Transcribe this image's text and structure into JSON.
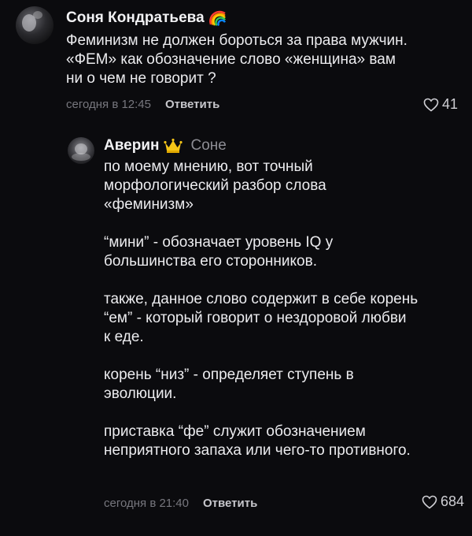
{
  "comments": [
    {
      "author": "Соня Кондратьева",
      "text": "Феминизм не должен бороться за права мужчин.\n«ФЕМ» как обозначение слово «женщина» вам\nни о чем не говорит ?",
      "time": "сегодня в 12:45",
      "reply_label": "Ответить",
      "likes": "41",
      "badge_icon": "rainbow-icon"
    },
    {
      "author": "Аверин",
      "reply_to": "Соне",
      "text": "по моему мнению, вот точный\nморфологический разбор слова\n«феминизм»\n\n“мини” - обозначает уровень IQ у\nбольшинства его сторонников.\n\nтакже, данное слово содержит в себе корень\n“ем” - который говорит о нездоровой любви\nк еде.\n\nкорень “низ” - определяет ступень в\nэволюции.\n\nприставка “фе” служит обозначением\nнеприятного запаха или чего-то противного.",
      "time": "сегодня в 21:40",
      "reply_label": "Ответить",
      "likes": "684",
      "badge_icon": "crown-icon"
    }
  ],
  "colors": {
    "background": "#0b0b0e",
    "text": "#ececef",
    "muted": "#77777e"
  }
}
